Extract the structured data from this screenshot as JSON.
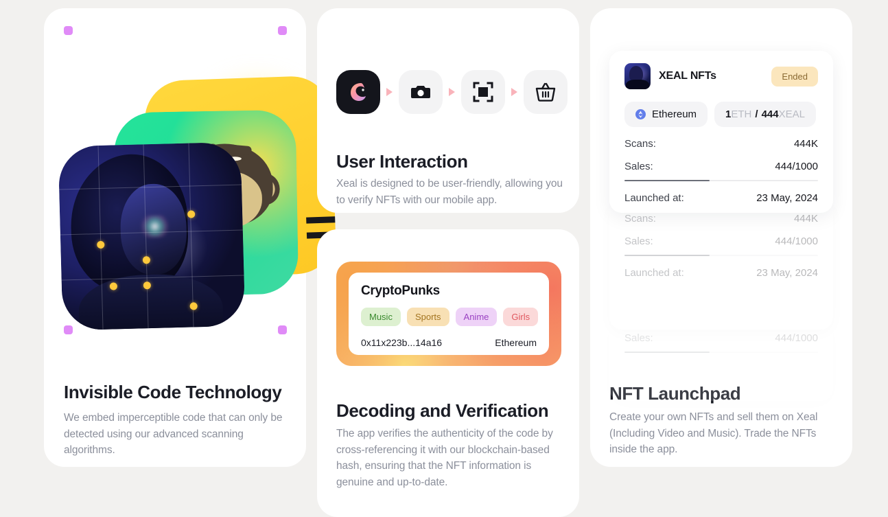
{
  "features": {
    "invisible": {
      "title": "Invisible Code Technology",
      "description": "We embed imperceptible code that can only be detected using our advanced scanning algorithms.",
      "marker_color": "#e08bf7"
    },
    "user_interaction": {
      "title": "User Interaction",
      "description": "Xeal is designed to be user-friendly, allowing you to verify NFTs with our mobile app.",
      "steps": [
        {
          "icon": "xeal-logo-icon",
          "label": "Xeal app"
        },
        {
          "icon": "camera-icon",
          "label": "Capture"
        },
        {
          "icon": "scan-frame-icon",
          "label": "Scan"
        },
        {
          "icon": "basket-icon",
          "label": "Buy"
        }
      ],
      "arrow_color": "#f9b3ba"
    },
    "decoding": {
      "title": "Decoding and Verification",
      "description": "The app verifies the authenticity of the code by cross-referencing it with our blockchain-based hash, ensuring that the NFT information is genuine and up-to-date.",
      "nft_card": {
        "name": "CryptoPunks",
        "tags": [
          {
            "label": "Music",
            "bg": "#ddf0d0",
            "fg": "#3a8a2e"
          },
          {
            "label": "Sports",
            "bg": "#f8e0b4",
            "fg": "#a37420"
          },
          {
            "label": "Anime",
            "bg": "#eed2f7",
            "fg": "#9a42c2"
          },
          {
            "label": "Girls",
            "bg": "#fbd9d9",
            "fg": "#e0585f"
          }
        ],
        "address": "0x11x223b...14a16",
        "chain": "Ethereum"
      }
    },
    "launchpad": {
      "title": "NFT Launchpad",
      "description": "Create your own NFTs and sell them on Xeal (Including Video and Music). Trade the NFTs inside the app.",
      "cards": [
        {
          "collection_name": "XEAL NFTs",
          "status_badge": "Ended",
          "chain": "Ethereum",
          "price_amount": "1",
          "price_unit": "ETH",
          "price_separator": "/",
          "supply_amount": "444",
          "supply_unit": "XEAL",
          "stats": [
            {
              "label": "Scans:",
              "value": "444K"
            },
            {
              "label": "Sales:",
              "value": "444/1000"
            },
            {
              "label": "Launched at:",
              "value": "23 May, 2024"
            }
          ],
          "progress_percent": 44
        },
        {
          "stats": [
            {
              "label": "Scans:",
              "value": "444K"
            },
            {
              "label": "Sales:",
              "value": "444/1000"
            },
            {
              "label": "Launched at:",
              "value": "23 May, 2024"
            }
          ],
          "progress_percent": 44
        },
        {
          "stats": [
            {
              "label": "Sales:",
              "value": "444/1000"
            }
          ],
          "progress_percent": 44
        }
      ]
    }
  },
  "theme": {
    "page_bg": "#f2f1ef",
    "card_bg": "#ffffff",
    "title_color": "#1b1d26",
    "body_color": "#8b8f9b",
    "badge_bg": "#fbe6bd",
    "badge_fg": "#8a6a33",
    "eth_blue": "#627eea"
  }
}
